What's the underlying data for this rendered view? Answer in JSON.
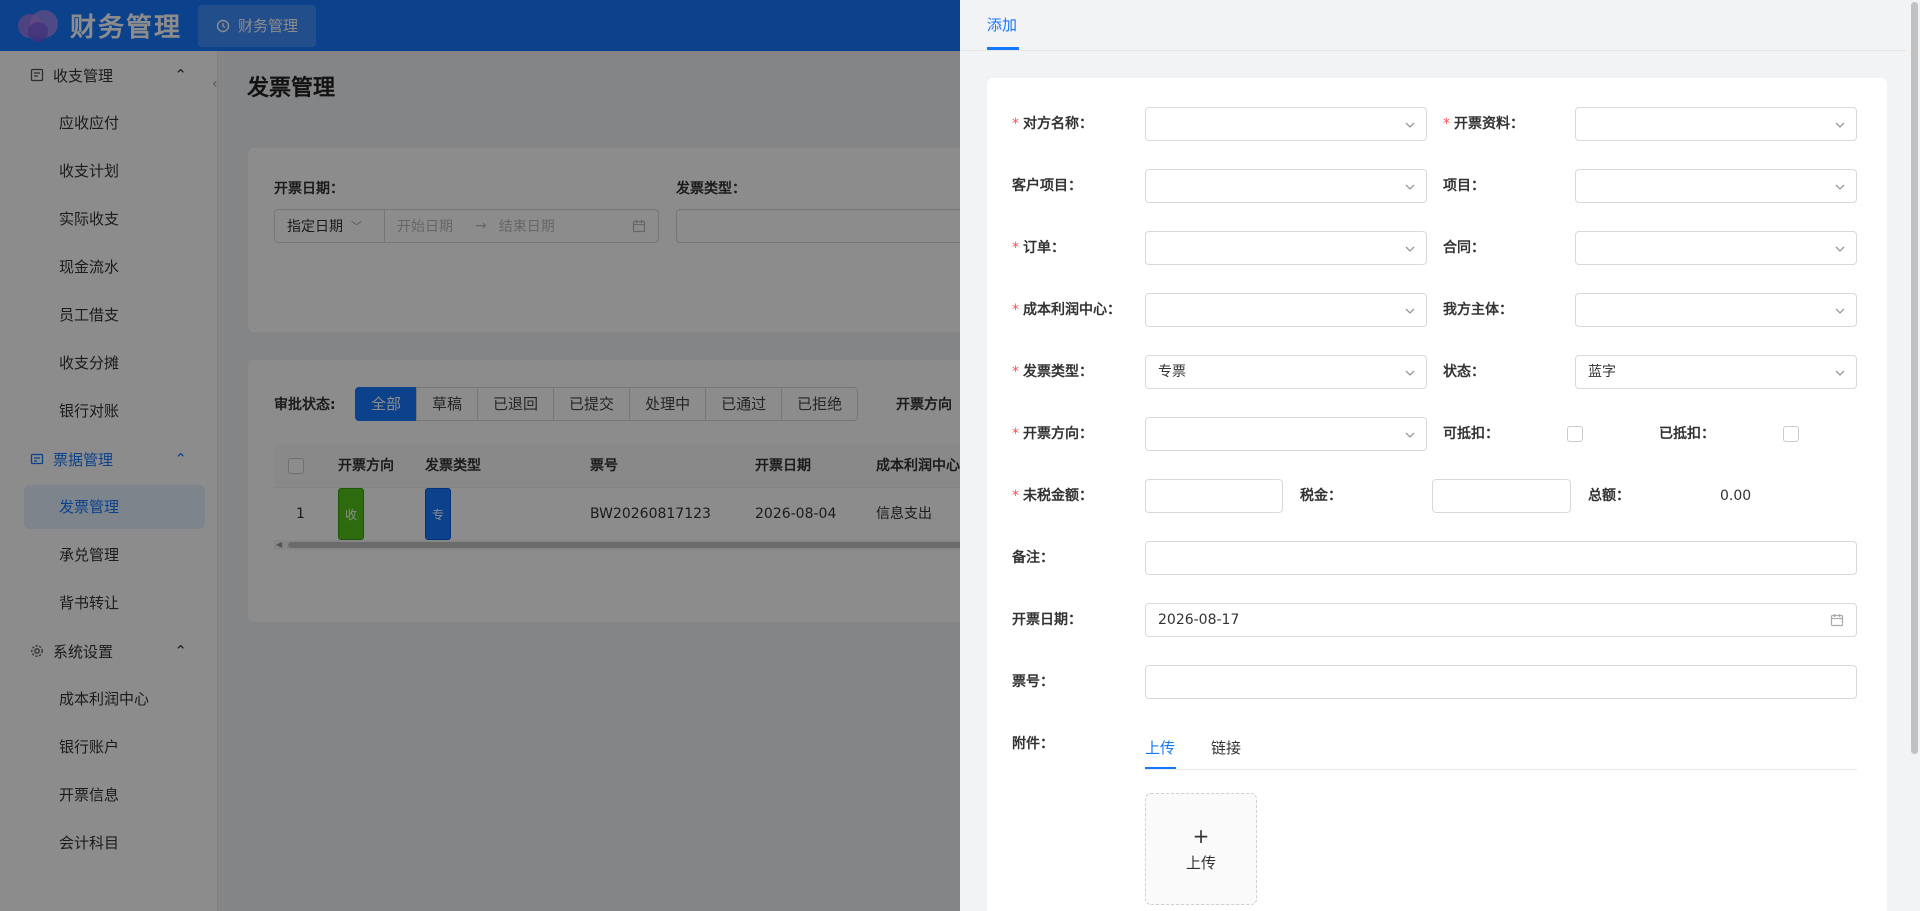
{
  "app": {
    "title": "财务管理",
    "top_tab": "财务管理"
  },
  "sidebar": {
    "groups": [
      {
        "label": "收支管理",
        "items": [
          "应收应付",
          "收支计划",
          "实际收支",
          "现金流水",
          "员工借支",
          "收支分摊",
          "银行对账"
        ]
      },
      {
        "label": "票据管理",
        "items": [
          "发票管理",
          "承兑管理",
          "背书转让"
        ]
      },
      {
        "label": "系统设置",
        "items": [
          "成本利润中心",
          "银行账户",
          "开票信息",
          "会计科目"
        ]
      }
    ]
  },
  "page": {
    "title": "发票管理",
    "filters": {
      "date_label": "开票日期：",
      "date_mode": "指定日期",
      "start_placeholder": "开始日期",
      "end_placeholder": "结束日期",
      "type_label": "发票类型："
    },
    "status_label": "审批状态:",
    "status_options": [
      "全部",
      "草稿",
      "已退回",
      "已提交",
      "处理中",
      "已通过",
      "已拒绝"
    ],
    "direction_label": "开票方向",
    "table": {
      "headers": [
        "开票方向",
        "发票类型",
        "票号",
        "开票日期",
        "成本利润中心"
      ],
      "rows": [
        {
          "index": "1",
          "direction": "收入",
          "type": "专票",
          "number": "BW20260817123",
          "date": "2026-08-04",
          "center": "信息支出"
        }
      ]
    }
  },
  "drawer": {
    "tab": "添加",
    "fields": {
      "counterparty": "对方名称：",
      "invoice_info": "开票资料：",
      "customer_project": "客户项目：",
      "project": "项目：",
      "order": "订单：",
      "contract": "合同：",
      "cost_center": "成本利润中心：",
      "our_entity": "我方主体：",
      "invoice_type": "发票类型：",
      "invoice_type_value": "专票",
      "status": "状态：",
      "status_value": "蓝字",
      "direction": "开票方向：",
      "deductible": "可抵扣：",
      "deducted": "已抵扣：",
      "pretax": "未税金额：",
      "tax": "税金：",
      "total": "总额：",
      "total_value": "0.00",
      "remark": "备注：",
      "invoice_date": "开票日期：",
      "invoice_date_value": "2026-08-17",
      "invoice_no": "票号：",
      "attachment": "附件："
    },
    "attachment_tabs": [
      "上传",
      "链接"
    ],
    "upload_label": "上传",
    "upload_plus": "+"
  },
  "colors": {
    "primary": "#1677ff",
    "required": "#ff4d4f",
    "tag_green": "#52c41a"
  }
}
